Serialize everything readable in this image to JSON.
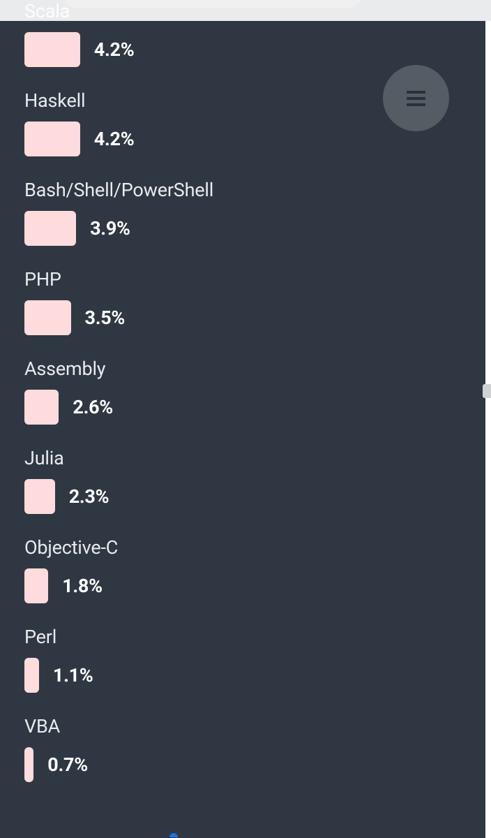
{
  "chart_data": {
    "type": "bar",
    "categories": [
      "Scala",
      "Haskell",
      "Bash/Shell/PowerShell",
      "PHP",
      "Assembly",
      "Julia",
      "Objective-C",
      "Perl",
      "VBA"
    ],
    "values": [
      4.2,
      4.2,
      3.9,
      3.5,
      2.6,
      2.3,
      1.8,
      1.1,
      0.7
    ],
    "series": [
      {
        "name": "percentage",
        "values": [
          4.2,
          4.2,
          3.9,
          3.5,
          2.6,
          2.3,
          1.8,
          1.1,
          0.7
        ]
      }
    ],
    "title": "",
    "xlabel": "",
    "ylabel": "",
    "ylim": [
      0,
      100
    ]
  },
  "items": [
    {
      "label": "Scala",
      "value_text": "4.2%",
      "pct": 4.2
    },
    {
      "label": "Haskell",
      "value_text": "4.2%",
      "pct": 4.2
    },
    {
      "label": "Bash/Shell/PowerShell",
      "value_text": "3.9%",
      "pct": 3.9
    },
    {
      "label": "PHP",
      "value_text": "3.5%",
      "pct": 3.5
    },
    {
      "label": "Assembly",
      "value_text": "2.6%",
      "pct": 2.6
    },
    {
      "label": "Julia",
      "value_text": "2.3%",
      "pct": 2.3
    },
    {
      "label": "Objective-C",
      "value_text": "1.8%",
      "pct": 1.8
    },
    {
      "label": "Perl",
      "value_text": "1.1%",
      "pct": 1.1
    },
    {
      "label": "VBA",
      "value_text": "0.7%",
      "pct": 0.7
    }
  ],
  "bar_scale": 19,
  "first_item_offset": -18
}
